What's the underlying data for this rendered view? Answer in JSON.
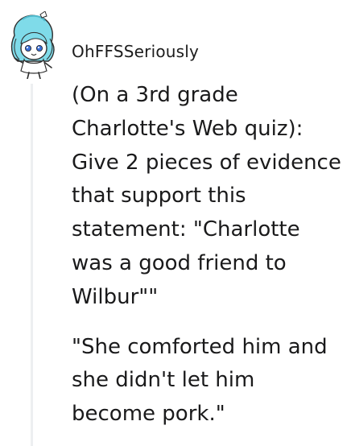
{
  "comment": {
    "author": {
      "username": "OhFFSSeriously",
      "avatar_icon": "snoo-avatar-icon"
    },
    "body": {
      "paragraph_1_lines": [
        "(On a 3rd grade",
        "Charlotte's Web quiz):",
        "Give 2 pieces of evidence",
        "that support this",
        "statement: \"Charlotte",
        "was a good friend to",
        "Wilbur\"\""
      ],
      "paragraph_2_lines": [
        "\"She comforted him and",
        "she didn't let him",
        "become pork.\""
      ]
    },
    "colors": {
      "text": "#1a1a1b",
      "thread_line": "#edeff1",
      "avatar_hair": "#6fd3e6",
      "avatar_face": "#ffffff"
    }
  }
}
